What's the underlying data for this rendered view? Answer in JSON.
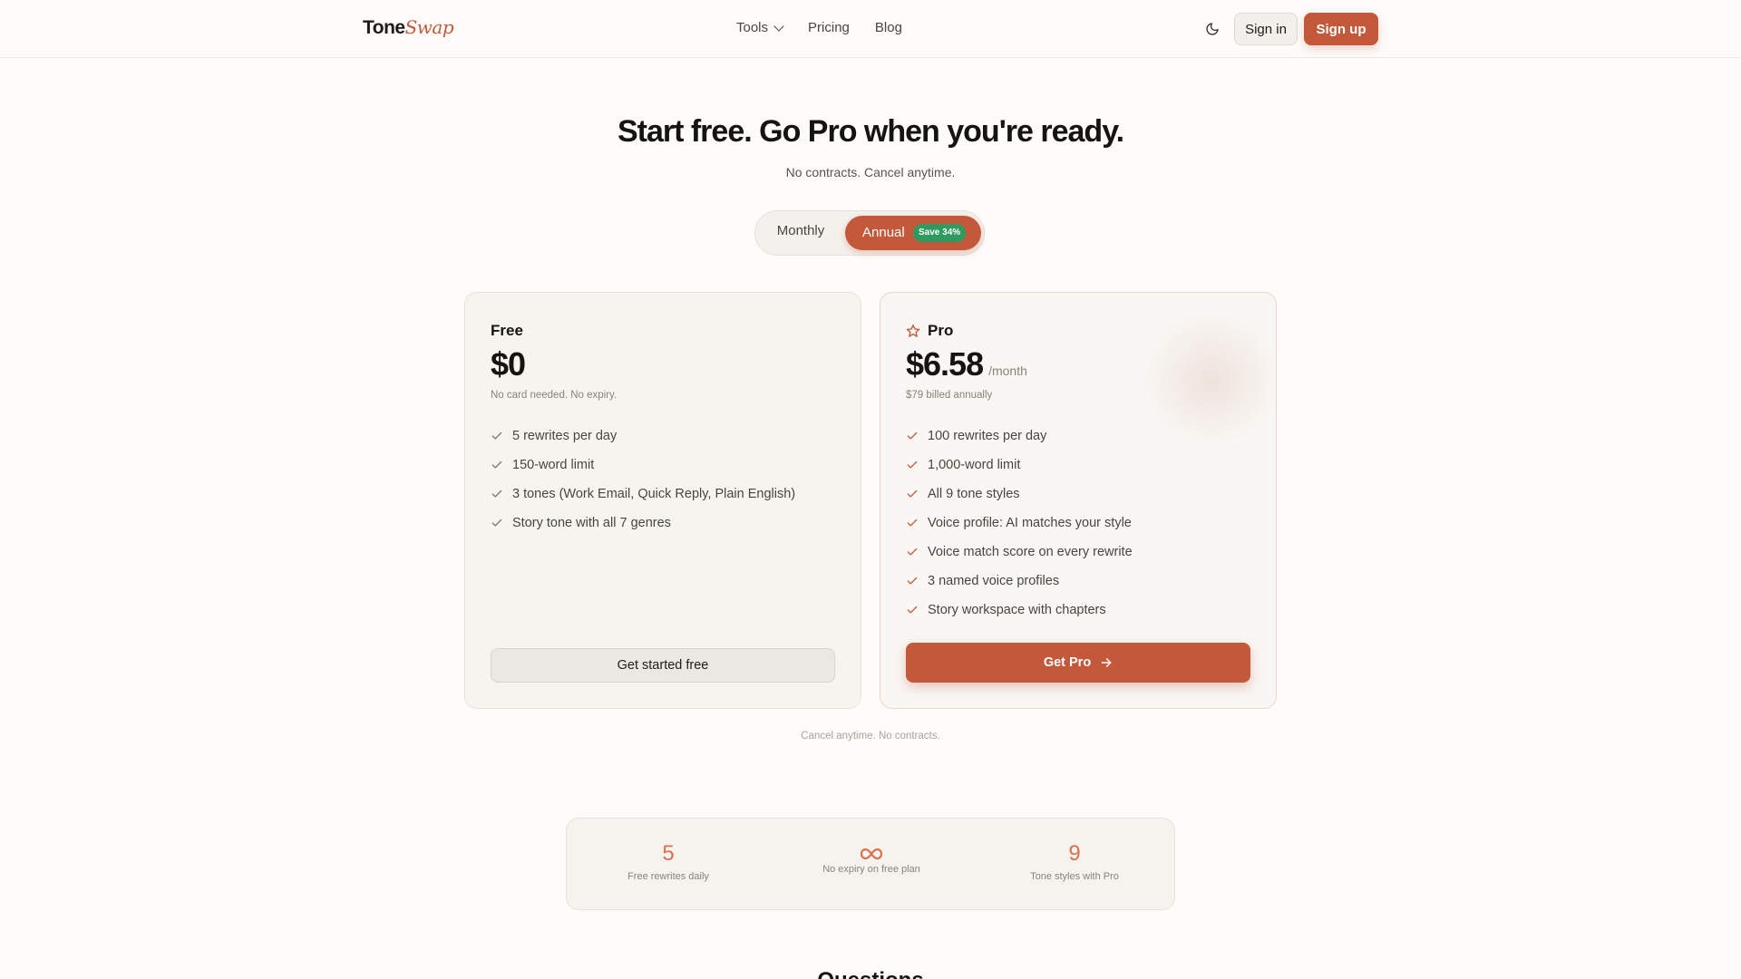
{
  "header": {
    "logo_main": "Tone",
    "logo_accent": "Swap",
    "nav": [
      {
        "label": "Tools",
        "has_dropdown": true
      },
      {
        "label": "Pricing",
        "has_dropdown": false
      },
      {
        "label": "Blog",
        "has_dropdown": false
      }
    ],
    "theme_icon": "moon-icon",
    "sign_in": "Sign in",
    "sign_up": "Sign up"
  },
  "hero": {
    "title": "Start free. Go Pro when you're ready.",
    "subtitle": "No contracts. Cancel anytime."
  },
  "billing_toggle": {
    "monthly": "Monthly",
    "annual": "Annual",
    "save_badge": "Save 34%",
    "selected": "Annual"
  },
  "plans": {
    "free": {
      "name": "Free",
      "price": "$0",
      "note": "No card needed. No expiry.",
      "features": [
        "5 rewrites per day",
        "150-word limit",
        "3 tones (Work Email, Quick Reply, Plain English)",
        "Story tone with all 7 genres"
      ],
      "cta": "Get started free"
    },
    "pro": {
      "name": "Pro",
      "icon": "star-icon",
      "price": "$6.58",
      "per": "/month",
      "note": "$79 billed annually",
      "features": [
        "100 rewrites per day",
        "1,000-word limit",
        "All 9 tone styles",
        "Voice profile: AI matches your style",
        "Voice match score on every rewrite",
        "3 named voice profiles",
        "Story workspace with chapters"
      ],
      "cta": "Get Pro"
    }
  },
  "footer_note": "Cancel anytime. No contracts.",
  "stats": [
    {
      "value": "5",
      "label": "Free rewrites daily"
    },
    {
      "value": "",
      "icon": "infinity-icon",
      "label": "No expiry on free plan"
    },
    {
      "value": "9",
      "label": "Tone styles with Pro"
    }
  ],
  "next_section_heading": "Questions",
  "colors": {
    "accent": "#c4583a",
    "badge_green": "#2e9a5f",
    "stat_orange": "#d9714f"
  }
}
